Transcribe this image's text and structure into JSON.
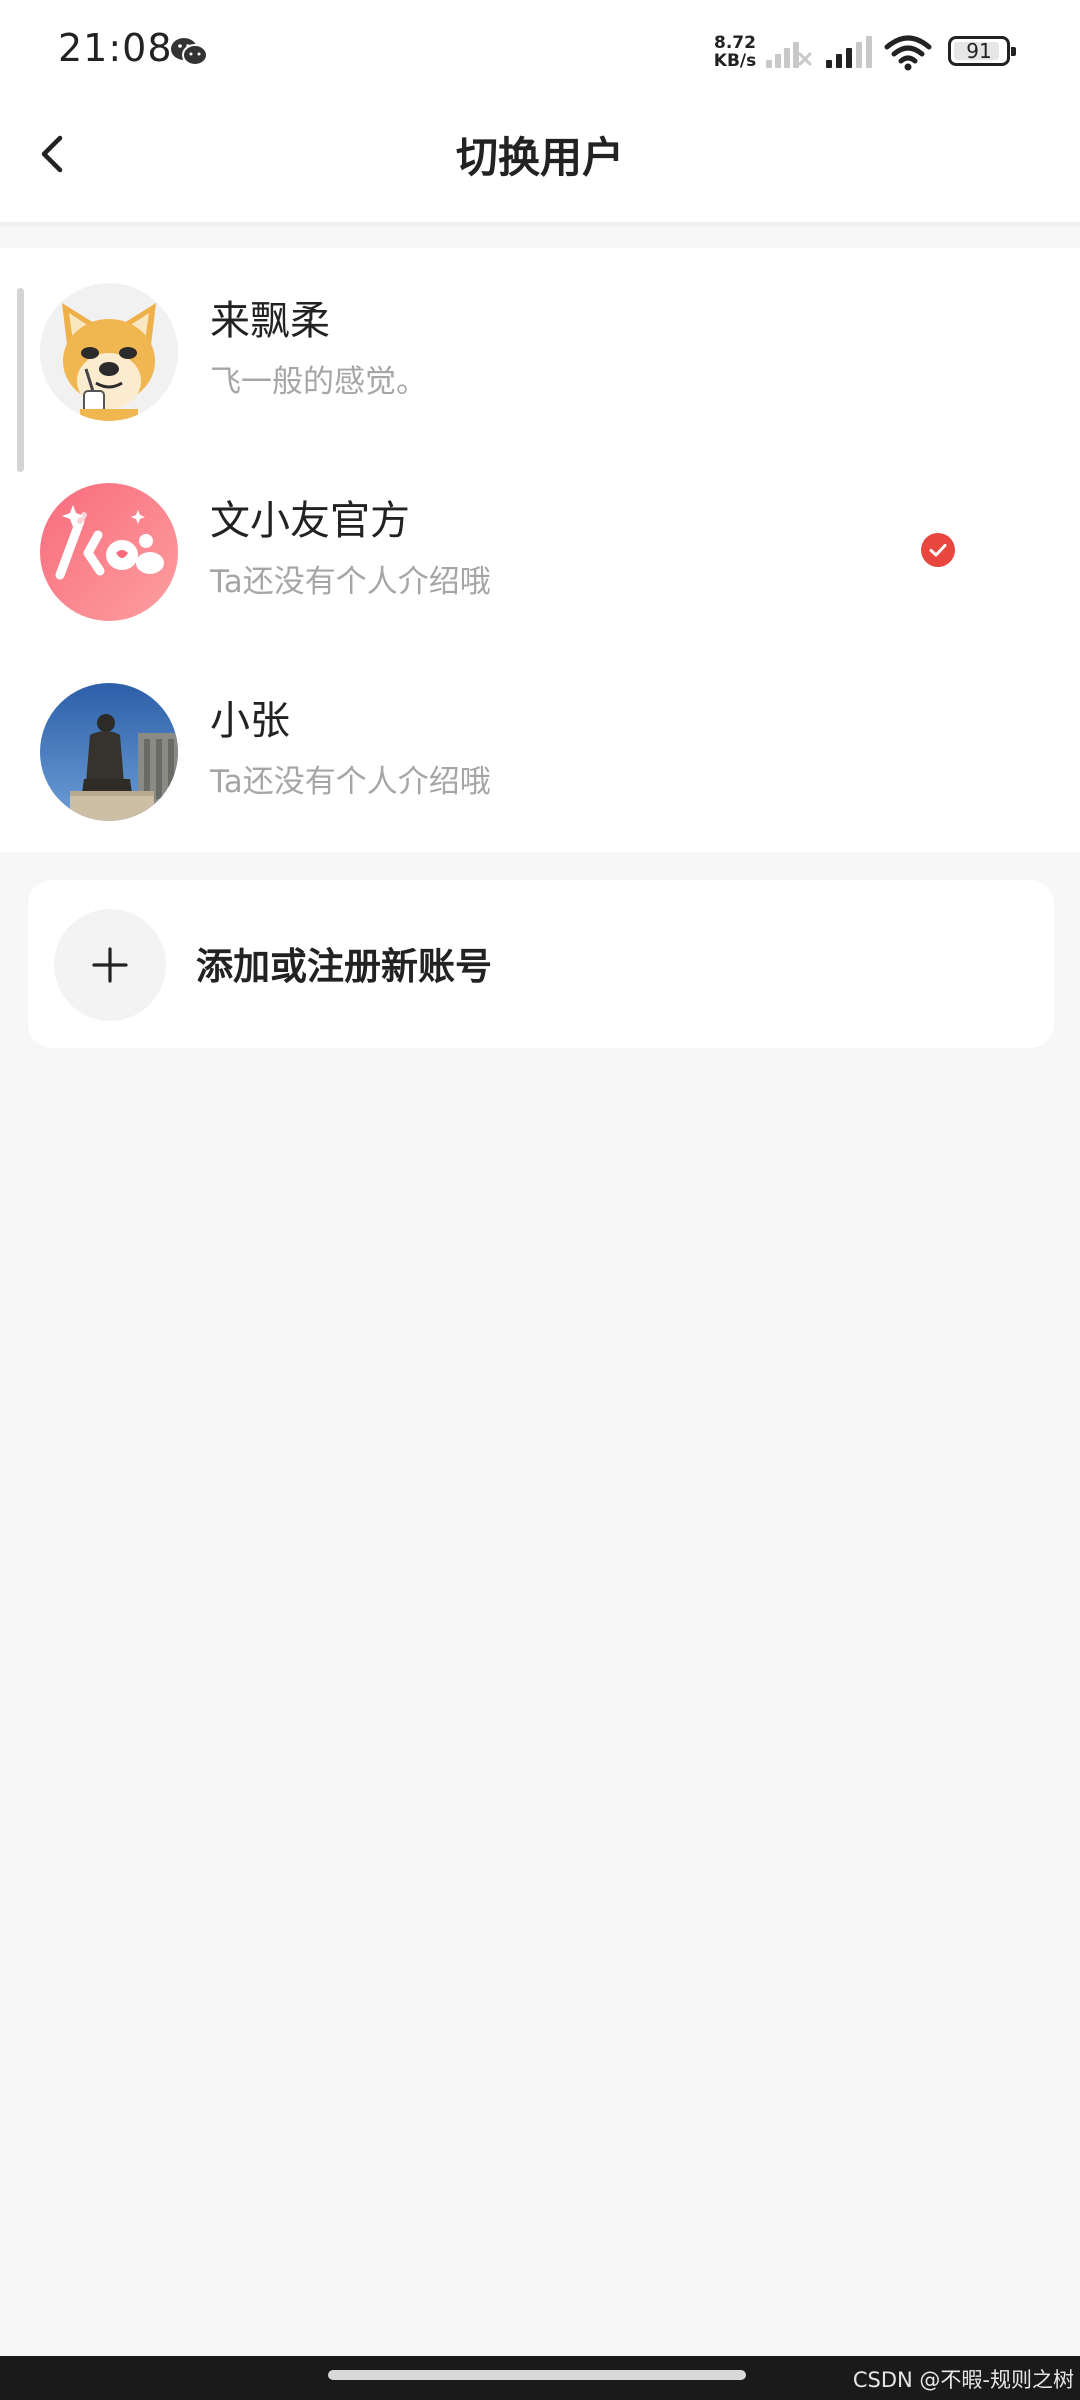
{
  "status_bar": {
    "time": "21:08",
    "net_speed_value": "8.72",
    "net_speed_unit": "KB/s",
    "battery_level": 91,
    "battery_text": "91",
    "icons": [
      "wechat-icon",
      "signal-no-service-icon",
      "signal-icon",
      "wifi-icon",
      "battery-icon"
    ]
  },
  "header": {
    "title": "切换用户",
    "back_icon": "chevron-left-icon"
  },
  "accounts": [
    {
      "name": "来飘柔",
      "bio": "飞一般的感觉。",
      "selected": false,
      "avatar": "doge-avatar"
    },
    {
      "name": "文小友官方",
      "bio": "Ta还没有个人介绍哦",
      "selected": true,
      "avatar": "brand-logo-avatar"
    },
    {
      "name": "小张",
      "bio": "Ta还没有个人介绍哦",
      "selected": false,
      "avatar": "statue-photo-avatar"
    }
  ],
  "add_account": {
    "label": "添加或注册新账号",
    "icon": "plus-icon"
  },
  "footer": {
    "watermark": "CSDN @不暇-规则之树"
  },
  "colors": {
    "accent_red": "#e8463f",
    "page_bg": "#f7f7f7",
    "card_bg": "#ffffff",
    "secondary_text": "#a6a6a6"
  }
}
